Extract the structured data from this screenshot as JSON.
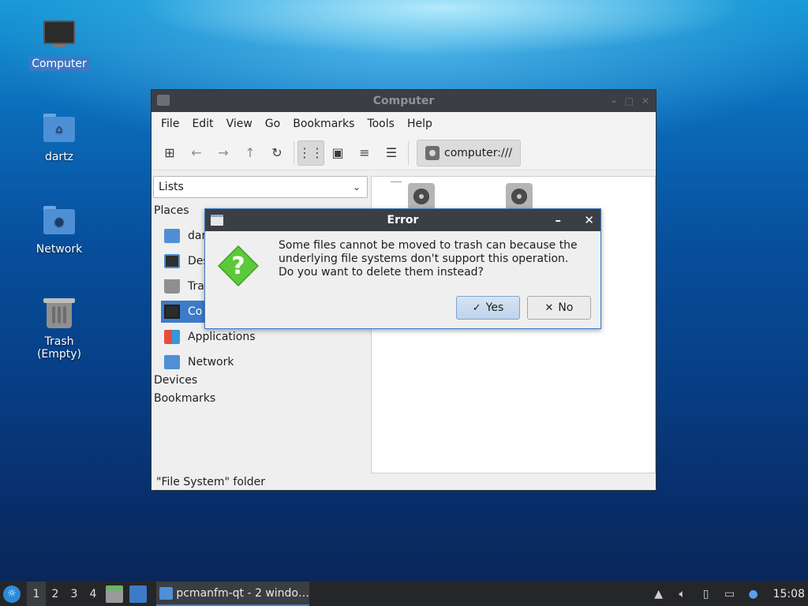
{
  "desktop": {
    "icons": [
      {
        "label": "Computer",
        "icon": "monitor-icon"
      },
      {
        "label": "dartz",
        "icon": "home-folder-icon"
      },
      {
        "label": "Network",
        "icon": "network-folder-icon"
      },
      {
        "label": "Trash (Empty)",
        "icon": "trash-icon"
      }
    ]
  },
  "window": {
    "title": "Computer",
    "menu": [
      "File",
      "Edit",
      "View",
      "Go",
      "Bookmarks",
      "Tools",
      "Help"
    ],
    "address": "computer:///",
    "side_pane_mode": "Lists",
    "places_header": "Places",
    "places": [
      {
        "label": "dar",
        "icon": "home-folder-icon"
      },
      {
        "label": "Des",
        "icon": "desktop-icon"
      },
      {
        "label": "Tra",
        "icon": "trash-icon"
      },
      {
        "label": "Co",
        "icon": "computer-icon"
      },
      {
        "label": "Applications",
        "icon": "applications-icon"
      },
      {
        "label": "Network",
        "icon": "network-icon"
      }
    ],
    "devices_header": "Devices",
    "bookmarks_header": "Bookmarks",
    "status": "\"File System\" folder"
  },
  "dialog": {
    "title": "Error",
    "message_line1": "Some files cannot be moved to trash can because the",
    "message_line2": "underlying file systems don't support this operation.",
    "message_line3": "Do you want to delete them instead?",
    "yes_label": "Yes",
    "no_label": "No"
  },
  "taskbar": {
    "workspaces": [
      "1",
      "2",
      "3",
      "4"
    ],
    "task_label": "pcmanfm-qt - 2 windo…",
    "clock": "15:08"
  },
  "colors": {
    "accent": "#3d7ac8",
    "titlebar": "#3b3e44",
    "question_icon": "#5cc93b"
  }
}
